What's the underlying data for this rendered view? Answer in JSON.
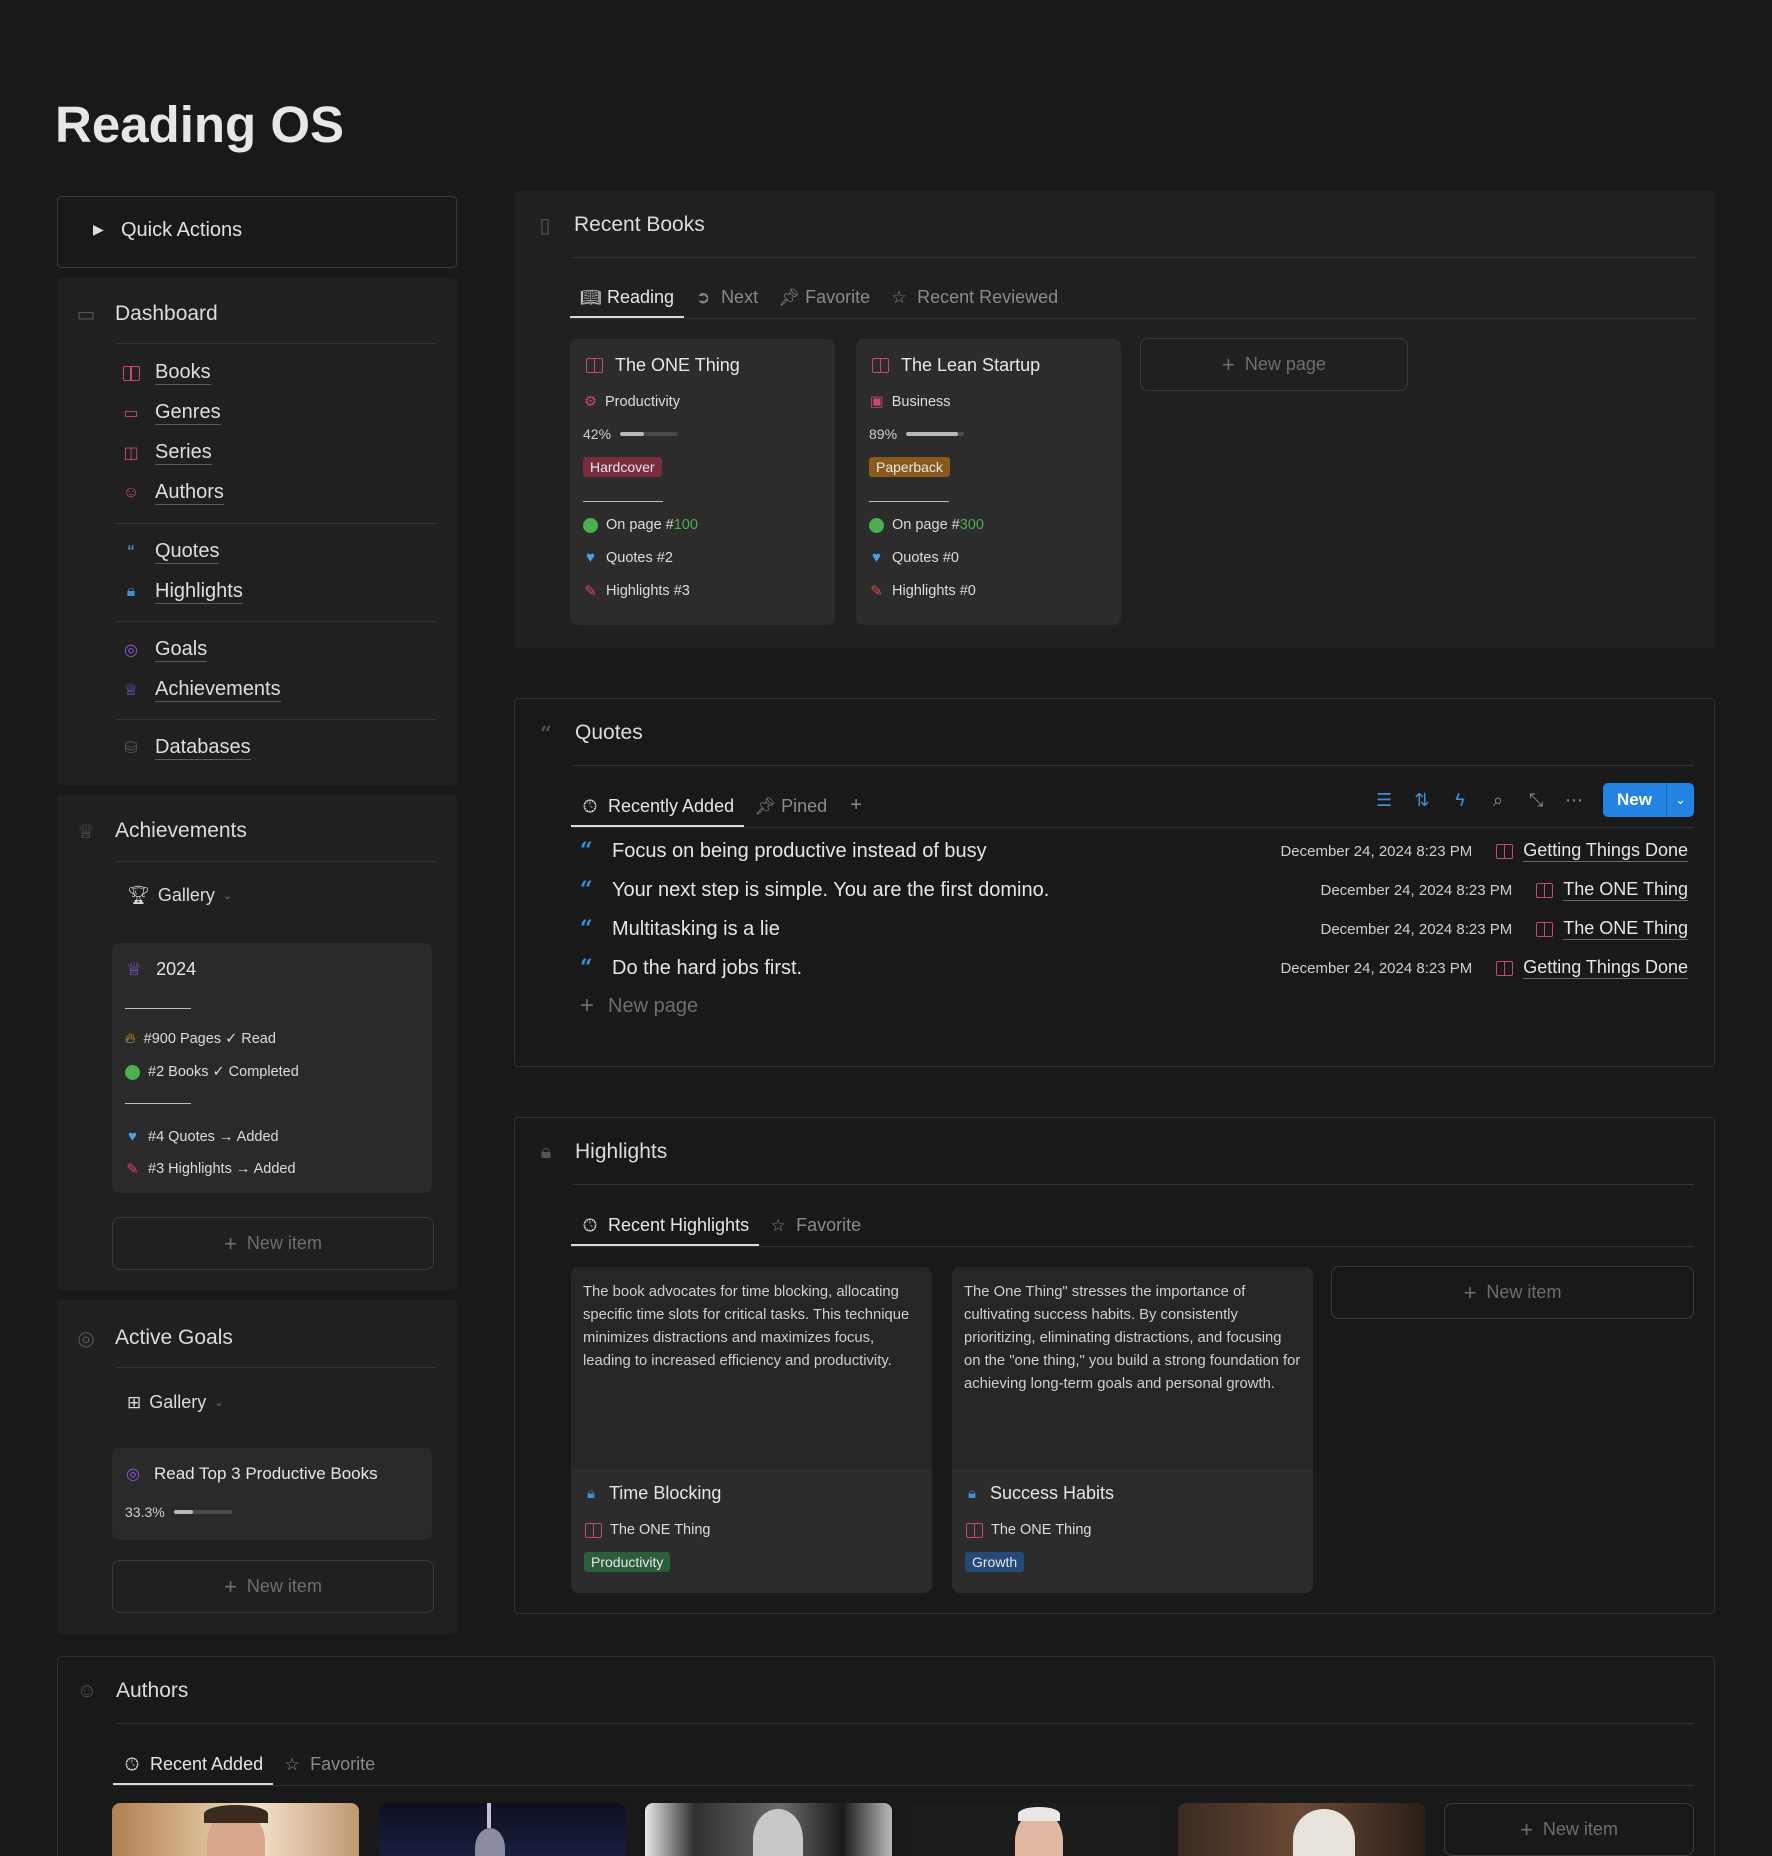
{
  "page": {
    "title": "Reading OS"
  },
  "quick_actions": {
    "label": "Quick Actions"
  },
  "dashboard": {
    "title": "Dashboard",
    "groups": [
      [
        {
          "label": "Books",
          "icon": "book-icon"
        },
        {
          "label": "Genres",
          "icon": "folder-icon"
        },
        {
          "label": "Series",
          "icon": "series-icon"
        },
        {
          "label": "Authors",
          "icon": "user-icon"
        }
      ],
      [
        {
          "label": "Quotes",
          "icon": "quote-icon"
        },
        {
          "label": "Highlights",
          "icon": "highlighter-icon"
        }
      ],
      [
        {
          "label": "Goals",
          "icon": "target-icon"
        },
        {
          "label": "Achievements",
          "icon": "trophy-icon"
        }
      ],
      [
        {
          "label": "Databases",
          "icon": "database-icon"
        }
      ]
    ]
  },
  "achievements": {
    "title": "Achievements",
    "view": "Gallery",
    "card": {
      "year": "2024",
      "lines": [
        "#900 Pages ✓ Read",
        "#2 Books ✓ Completed",
        "#4 Quotes → Added",
        "#3 Highlights → Added"
      ]
    },
    "new_item": "New item"
  },
  "active_goals": {
    "title": "Active Goals",
    "view": "Gallery",
    "goal": {
      "title": "Read Top 3 Productive Books",
      "progress_label": "33.3%",
      "progress": 0.333
    },
    "new_item": "New item"
  },
  "recent_books": {
    "title": "Recent Books",
    "tabs": [
      "Reading",
      "Next",
      "Favorite",
      "Recent Reviewed"
    ],
    "books": [
      {
        "title": "The ONE Thing",
        "genre": "Productivity",
        "progress_label": "42%",
        "progress": 0.42,
        "format": "Hardcover",
        "format_color": "#7a2c3f",
        "page_prefix": "On page #",
        "page": "100",
        "quotes": "Quotes #2",
        "highlights": "Highlights #3"
      },
      {
        "title": "The Lean Startup",
        "genre": "Business",
        "progress_label": "89%",
        "progress": 0.89,
        "format": "Paperback",
        "format_color": "#8a5a1c",
        "page_prefix": "On page #",
        "page": "300",
        "quotes": "Quotes #0",
        "highlights": "Highlights #0"
      }
    ],
    "new_page": "New page"
  },
  "quotes": {
    "title": "Quotes",
    "tabs": [
      "Recently Added",
      "Pined"
    ],
    "new_button": "New",
    "rows": [
      {
        "text": "Focus on being productive instead of busy",
        "date": "December 24, 2024 8:23 PM",
        "book": "Getting Things Done"
      },
      {
        "text": "Your next step is simple. You are the first domino.",
        "date": "December 24, 2024 8:23 PM",
        "book": "The ONE Thing"
      },
      {
        "text": "Multitasking is a lie",
        "date": "December 24, 2024 8:23 PM",
        "book": "The ONE Thing"
      },
      {
        "text": "Do the hard jobs first.",
        "date": "December 24, 2024 8:23 PM",
        "book": "Getting Things Done"
      }
    ],
    "new_page": "New page"
  },
  "highlights": {
    "title": "Highlights",
    "tabs": [
      "Recent Highlights",
      "Favorite"
    ],
    "cards": [
      {
        "text": "The book advocates for time blocking, allocating specific time slots for critical tasks. This technique minimizes distractions and maximizes focus, leading to increased efficiency and productivity.",
        "title": "Time Blocking",
        "book": "The ONE Thing",
        "tag": "Productivity",
        "tag_color": "#2b5e3b"
      },
      {
        "text": "The One Thing\" stresses the importance of cultivating success habits. By consistently prioritizing, eliminating distractions, and focusing on the \"one thing,\" you build a strong foundation for achieving long-term goals and personal growth.",
        "title": "Success Habits",
        "book": "The ONE Thing",
        "tag": "Growth",
        "tag_color": "#244a7a"
      }
    ],
    "new_item": "New item"
  },
  "authors": {
    "title": "Authors",
    "tabs": [
      "Recent Added",
      "Favorite"
    ],
    "new_item": "New item"
  },
  "colors": {
    "accent": "#2383e2",
    "book_pink": "#c5487d",
    "quote_blue": "#3f8fd6",
    "page_green": "#4caf50"
  }
}
